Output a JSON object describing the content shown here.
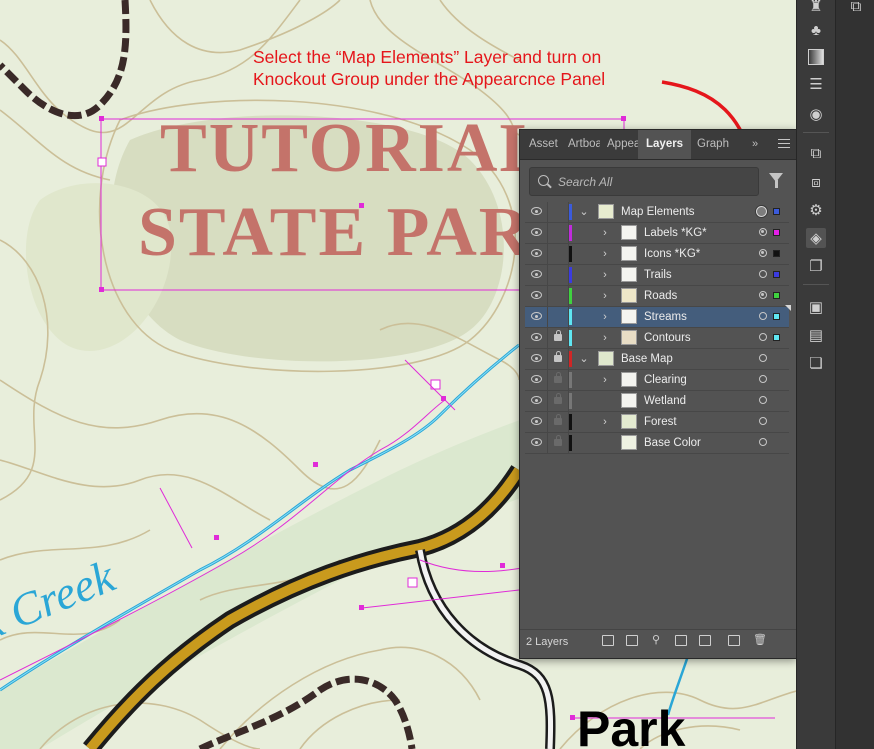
{
  "annotation": {
    "line1": "Select the “Map Elements” Layer and turn on",
    "line2": "Knockout Group under the Appearcnce Panel",
    "color": "#e5161b"
  },
  "map": {
    "title_line1": "TUTORIAL",
    "title_line2": "STATE PAR",
    "creek_label": "k Creek",
    "park_label": "Park",
    "title_color": "#c4736a",
    "creek_color": "#2aa6d6"
  },
  "panel": {
    "tabs": [
      "Asset",
      "Artboa",
      "Appea",
      "Layers",
      "Graph"
    ],
    "active_tab": "Layers",
    "overflow_label": "»",
    "search": {
      "placeholder": "Search All"
    },
    "layer_count": "2 Layers",
    "rows": [
      {
        "name": "Map Elements",
        "color": "#3b5bdb",
        "selection_color": "#3b5bdb"
      },
      {
        "name": "Labels *KG*",
        "color": "#c02bdc",
        "selection_color": "#e41fe8"
      },
      {
        "name": "Icons *KG*",
        "color": "#111111",
        "selection_color": "#111111"
      },
      {
        "name": "Trails",
        "color": "#3b3be0",
        "selection_color": "#3b3be0"
      },
      {
        "name": "Roads",
        "color": "#3fd23f",
        "selection_color": "#3fd23f"
      },
      {
        "name": "Streams",
        "color": "#5fe6f2",
        "selection_color": "#5fe6f2"
      },
      {
        "name": "Contours",
        "color": "#5fe6f2",
        "selection_color": "#5fe6f2"
      },
      {
        "name": "Base Map",
        "color": "#d02626",
        "selection_color": ""
      },
      {
        "name": "Clearing",
        "color": "#777777",
        "selection_color": ""
      },
      {
        "name": "Wetland",
        "color": "#777777",
        "selection_color": ""
      },
      {
        "name": "Forest",
        "color": "#111111",
        "selection_color": ""
      },
      {
        "name": "Base Color",
        "color": "#111111",
        "selection_color": ""
      }
    ]
  },
  "toolbar": {
    "icons": [
      "chess-piece-icon",
      "club-icon",
      "gradient-icon",
      "stroke-lines-icon",
      "transparency-icon",
      "export-icon",
      "artboards-icon",
      "appearance-icon",
      "layers-icon",
      "asset-export-icon",
      "transform-icon",
      "align-icon",
      "pathfinder-icon"
    ],
    "active": "layers-icon"
  }
}
